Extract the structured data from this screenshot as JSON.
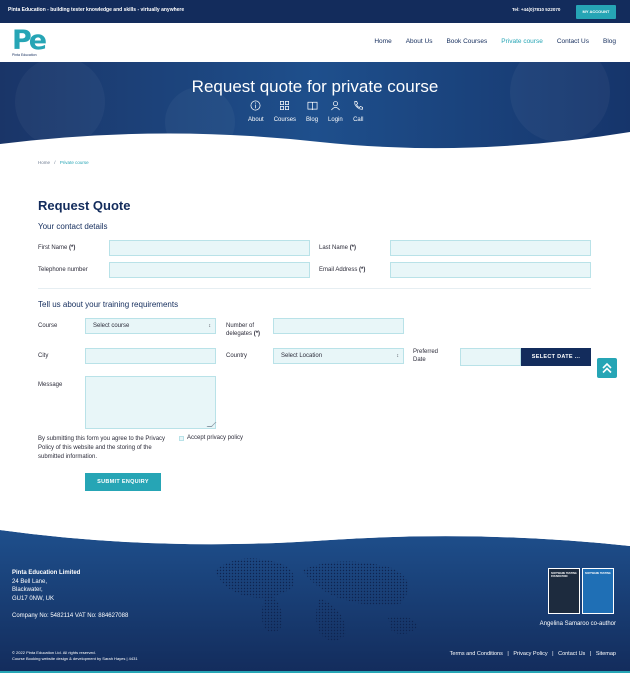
{
  "topbar": {
    "tagline": "Pinta Education - building tester knowledge and skills - virtually anywhere",
    "tel": "Tel: +44(0)7810 522070",
    "account_button": "MY ACCOUNT"
  },
  "header": {
    "logo_mark": "Pe",
    "logo_caption": "Pinta Education",
    "nav": [
      "Home",
      "About Us",
      "Book Courses",
      "Private course",
      "Contact Us",
      "Blog"
    ],
    "active_nav": "Private course"
  },
  "hero": {
    "title": "Request quote for private course",
    "links": [
      {
        "label": "About",
        "icon": "info-icon"
      },
      {
        "label": "Courses",
        "icon": "grid-icon"
      },
      {
        "label": "Blog",
        "icon": "book-icon"
      },
      {
        "label": "Login",
        "icon": "user-icon"
      },
      {
        "label": "Call",
        "icon": "phone-icon"
      }
    ]
  },
  "breadcrumb": {
    "home": "Home",
    "separator": "/",
    "current": "Private course"
  },
  "form": {
    "heading": "Request Quote",
    "contact_heading": "Your contact details",
    "first_name_label": "First Name",
    "last_name_label": "Last Name",
    "telephone_label": "Telephone number",
    "email_label": "Email Address",
    "required_marker": "(*)",
    "training_heading": "Tell us about your training requirements",
    "course_label": "Course",
    "course_selected": "Select course",
    "delegates_label_1": "Number of",
    "delegates_label_2": "delegates",
    "city_label": "City",
    "country_label": "Country",
    "country_selected": "Select Location",
    "date_label_1": "Preferred",
    "date_label_2": "Date",
    "date_button": "SELECT DATE ...",
    "message_label": "Message",
    "agree_text": "By submitting this form you agree to the Privacy Policy of this website and the storing of the submitted information.",
    "privacy_label": "Accept privacy policy",
    "submit_label": "SUBMIT ENQUIRY"
  },
  "footer": {
    "company_name": "Pinta Education Limited",
    "address": [
      "24 Bell Lane,",
      "Blackwater,",
      "GU17 0NW, UK"
    ],
    "registration": "Company No: 5482114 VAT No: 884627088",
    "author": "Angelina Samaroo co-author",
    "book1_title": "SOFTWARE TESTING FOUNDATION",
    "book2_title": "SOFTWARE TESTING",
    "copyright": "© 2022 Pinta Education Ltd. All rights reserved.",
    "credit": "Course Booking website design & development by Sarah Hayes | 4431",
    "links": [
      "Terms and Conditions",
      "Privacy Policy",
      "Contact Us",
      "Sitemap"
    ],
    "link_separator": "|"
  },
  "colors": {
    "navy": "#132c5c",
    "teal": "#26a5b5",
    "field": "#e8f6f8"
  }
}
